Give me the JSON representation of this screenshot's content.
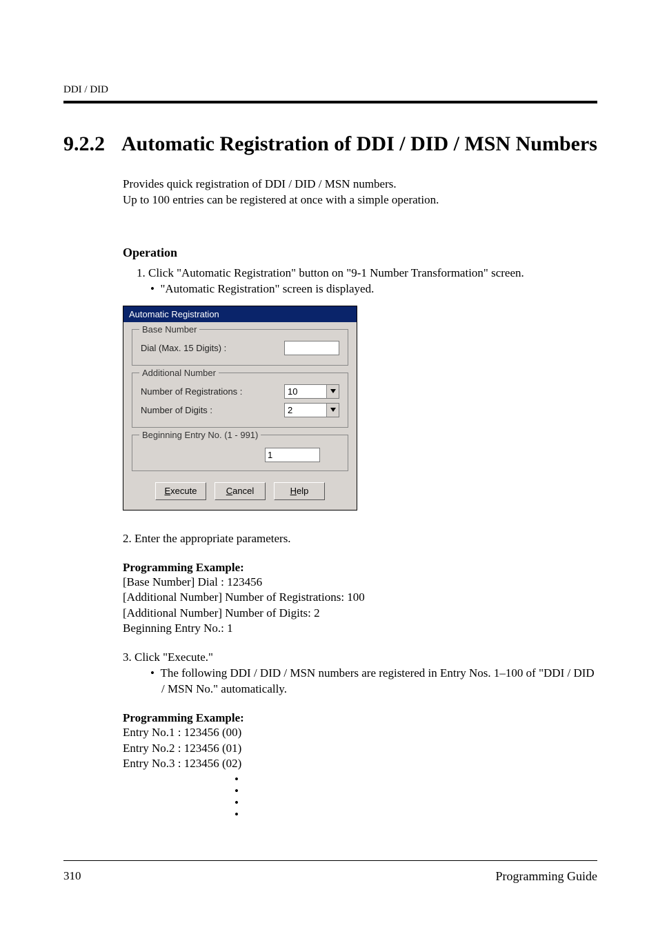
{
  "header": {
    "path": "DDI / DID"
  },
  "section": {
    "number": "9.2.2",
    "title": "Automatic Registration of DDI / DID / MSN Numbers"
  },
  "intro": {
    "line1": "Provides quick registration of DDI / DID / MSN numbers.",
    "line2": "Up to 100 entries can be registered at once with a simple operation."
  },
  "operation": {
    "heading": "Operation",
    "step1": "1. Click \"Automatic Registration\" button on \"9-1 Number Transformation\" screen.",
    "step1_bullet": "\"Automatic Registration\" screen is displayed.",
    "step2": "2. Enter the appropriate parameters.",
    "step3": "3. Click \"Execute.\"",
    "step3_bullet": "The following DDI / DID / MSN numbers are registered in Entry Nos. 1–100 of \"DDI / DID / MSN No.\" automatically."
  },
  "dialog": {
    "title": "Automatic Registration",
    "base_number_legend": "Base Number",
    "dial_label": "Dial (Max. 15 Digits) :",
    "dial_value": "",
    "additional_legend": "Additional Number",
    "registrations_label": "Number of Registrations :",
    "registrations_value": "10",
    "digits_label": "Number of Digits :",
    "digits_value": "2",
    "entry_legend": "Beginning Entry No. (1 - 991)",
    "entry_value": "1",
    "btn_execute": "Execute",
    "btn_cancel": "Cancel",
    "btn_help": "Help"
  },
  "example1": {
    "heading": "Programming Example:",
    "l1": "[Base Number] Dial : 123456",
    "l2": "[Additional Number] Number of Registrations: 100",
    "l3": "[Additional Number] Number of Digits: 2",
    "l4": "Beginning Entry No.: 1"
  },
  "example2": {
    "heading": "Programming Example:",
    "l1": "Entry No.1 : 123456 (00)",
    "l2": "Entry No.2 : 123456 (01)",
    "l3": "Entry No.3 : 123456 (02)"
  },
  "footer": {
    "page": "310",
    "title": "Programming Guide"
  }
}
